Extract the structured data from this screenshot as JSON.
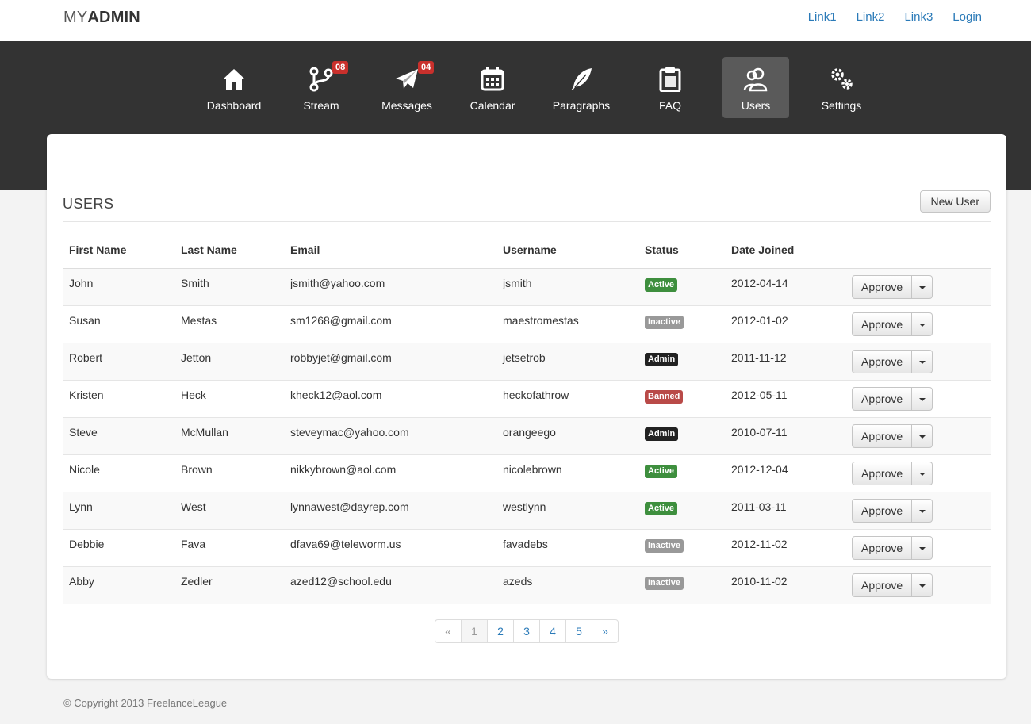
{
  "brand": {
    "part1": "MY",
    "part2": "ADMIN"
  },
  "top_links": [
    "Link1",
    "Link2",
    "Link3",
    "Login"
  ],
  "nav": [
    {
      "label": "Dashboard",
      "icon": "home-icon",
      "badge": ""
    },
    {
      "label": "Stream",
      "icon": "branch-icon",
      "badge": "08"
    },
    {
      "label": "Messages",
      "icon": "paper-plane-icon",
      "badge": "04"
    },
    {
      "label": "Calendar",
      "icon": "calendar-icon",
      "badge": ""
    },
    {
      "label": "Paragraphs",
      "icon": "feather-icon",
      "badge": ""
    },
    {
      "label": "FAQ",
      "icon": "clipboard-icon",
      "badge": ""
    },
    {
      "label": "Users",
      "icon": "users-icon",
      "badge": "",
      "active": true
    },
    {
      "label": "Settings",
      "icon": "gears-icon",
      "badge": ""
    }
  ],
  "section": {
    "title": "USERS",
    "new_user_label": "New User"
  },
  "table": {
    "headers": [
      "First Name",
      "Last Name",
      "Email",
      "Username",
      "Status",
      "Date Joined"
    ],
    "rows": [
      [
        "John",
        "Smith",
        "jsmith@yahoo.com",
        "jsmith",
        "Active",
        "2012-04-14"
      ],
      [
        "Susan",
        "Mestas",
        "sm1268@gmail.com",
        "maestromestas",
        "Inactive",
        "2012-01-02"
      ],
      [
        "Robert",
        "Jetton",
        "robbyjet@gmail.com",
        "jetsetrob",
        "Admin",
        "2011-11-12"
      ],
      [
        "Kristen",
        "Heck",
        "kheck12@aol.com",
        "heckofathrow",
        "Banned",
        "2012-05-11"
      ],
      [
        "Steve",
        "McMullan",
        "steveymac@yahoo.com",
        "orangeego",
        "Admin",
        "2010-07-11"
      ],
      [
        "Nicole",
        "Brown",
        "nikkybrown@aol.com",
        "nicolebrown",
        "Active",
        "2012-12-04"
      ],
      [
        "Lynn",
        "West",
        "lynnawest@dayrep.com",
        "westlynn",
        "Active",
        "2011-03-11"
      ],
      [
        "Debbie",
        "Fava",
        "dfava69@teleworm.us",
        "favadebs",
        "Inactive",
        "2012-11-02"
      ],
      [
        "Abby",
        "Zedler",
        "azed12@school.edu",
        "azeds",
        "Inactive",
        "2010-11-02"
      ]
    ],
    "action_label": "Approve"
  },
  "status_colors": {
    "Active": "#3e8f3e",
    "Inactive": "#999999",
    "Admin": "#222222",
    "Banned": "#b94a48"
  },
  "pagination": [
    "«",
    "1",
    "2",
    "3",
    "4",
    "5",
    "»"
  ],
  "pagination_active": "1",
  "footer": "© Copyright 2013 FreelanceLeague"
}
